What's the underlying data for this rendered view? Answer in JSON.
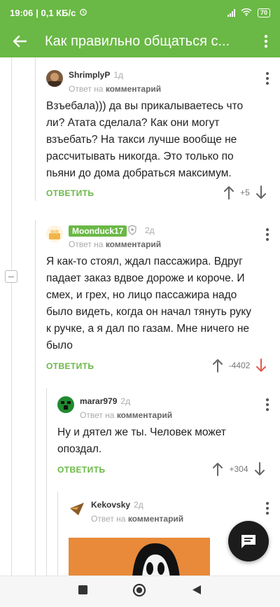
{
  "status": {
    "time": "19:06",
    "speed": "| 0,1 КБ/с",
    "battery": "70"
  },
  "appbar": {
    "title": "Как правильно общаться с..."
  },
  "comments": [
    {
      "user": "ShrimplyP",
      "age": "1д",
      "reply_prefix": "Ответ на",
      "reply_target": "комментарий",
      "text": "Взъебала))) да вы прикалываетесь что ли? Атата сделала? Как они могут взъебать? На такси лучше вообще не рассчитывать никогда. Это только по пьяни до дома добраться максимум.",
      "reply_label": "ОТВЕТИТЬ",
      "score": "+5"
    },
    {
      "user": "Moonduck17",
      "age": "2д",
      "reply_prefix": "Ответ на",
      "reply_target": "комментарий",
      "text": "Я как-то стоял, ждал пассажира. Вдруг падает заказ вдвое дороже и короче. И смех, и грех, но лицо пассажира надо было видеть, когда он начал тянуть руку к ручке, а я дал по газам. Мне ничего не было",
      "reply_label": "ОТВЕТИТЬ",
      "score": "-4402"
    },
    {
      "user": "marar979",
      "age": "2д",
      "reply_prefix": "Ответ на",
      "reply_target": "комментарий",
      "text": "Ну и дятел же ты. Человек может опоздал.",
      "reply_label": "ОТВЕТИТЬ",
      "score": "+304"
    },
    {
      "user": "Kekovsky",
      "age": "2д",
      "reply_prefix": "Ответ на",
      "reply_target": "комментарий"
    }
  ],
  "colors": {
    "accent": "#6ab845",
    "downvote": "#e05a4e",
    "fab": "#1c1c1c"
  },
  "icons": [
    "back-arrow-icon",
    "more-vert-icon",
    "upvote-arrow-icon",
    "downvote-arrow-icon",
    "shield-icon",
    "comment-fab-icon",
    "collapse-icon",
    "nav-stop-icon",
    "nav-home-icon",
    "nav-back-icon",
    "wifi-icon",
    "alarm-icon"
  ]
}
